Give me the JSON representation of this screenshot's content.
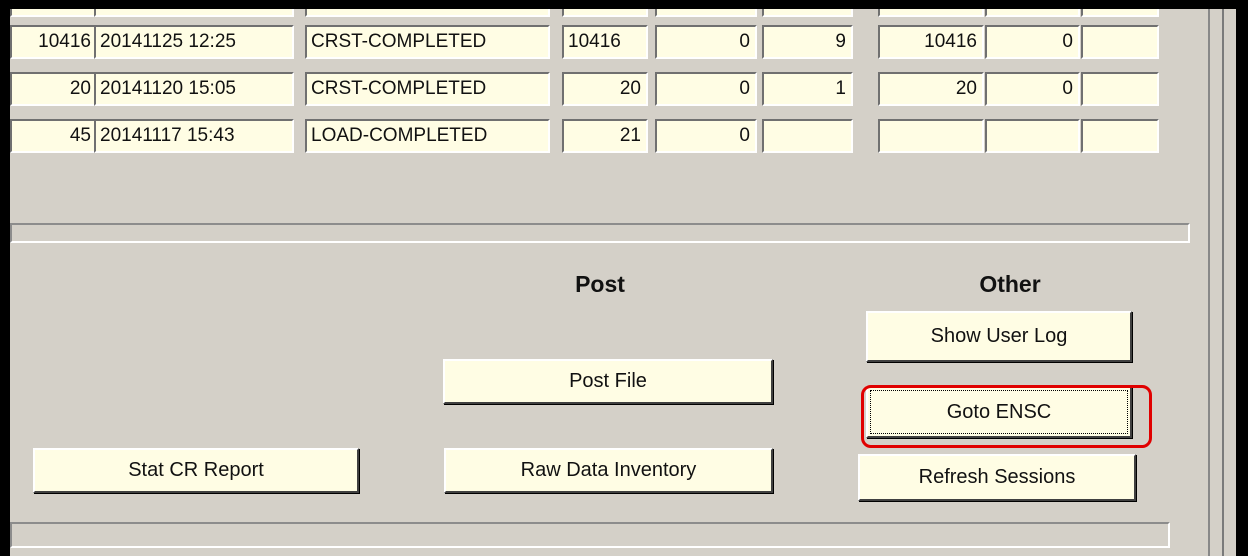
{
  "table": {
    "rows": [
      [
        "10416",
        "20141125 12:25",
        "CRST-COMPLETED",
        "10416",
        "0",
        "9",
        "10416",
        "0",
        ""
      ],
      [
        "20",
        "20141120 15:05",
        "CRST-COMPLETED",
        "20",
        "0",
        "1",
        "20",
        "0",
        ""
      ],
      [
        "45",
        "20141117 15:43",
        "LOAD-COMPLETED",
        "21",
        "0",
        "",
        "",
        "",
        ""
      ]
    ]
  },
  "sections": {
    "post_heading": "Post",
    "other_heading": "Other"
  },
  "buttons": {
    "stat_cr_report": "Stat CR Report",
    "post_file": "Post File",
    "raw_data_inventory": "Raw Data Inventory",
    "show_user_log": "Show User Log",
    "goto_ensc": "Goto ENSC",
    "refresh_sessions": "Refresh Sessions"
  },
  "colors": {
    "panel_background": "#d4d0c8",
    "field_background": "#fffde4",
    "highlight": "#e00000"
  }
}
